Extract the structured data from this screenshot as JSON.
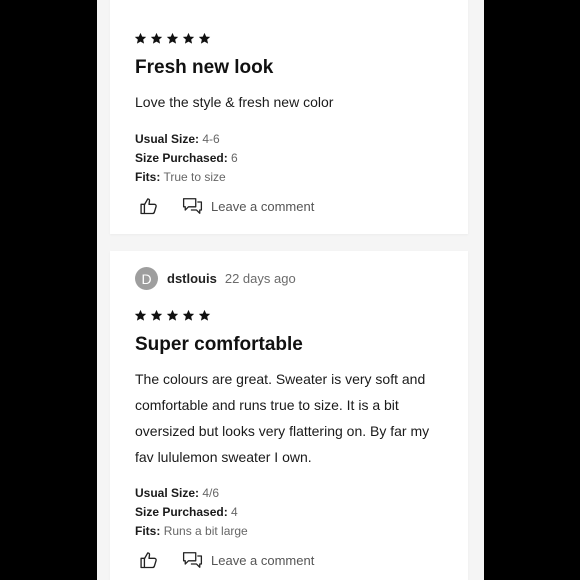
{
  "reviews": [
    {
      "rating": 5,
      "title": "Fresh new look",
      "body": "Love the style & fresh new color",
      "usual_size_label": "Usual Size:",
      "usual_size": "4-6",
      "size_purchased_label": "Size Purchased:",
      "size_purchased": "6",
      "fits_label": "Fits:",
      "fits": "True to size",
      "comment_label": "Leave a comment"
    },
    {
      "avatar_letter": "D",
      "username": "dstlouis",
      "time": "22 days ago",
      "rating": 5,
      "title": "Super comfortable",
      "body": "The colours are great. Sweater is very soft and comfortable and runs true to size. It is a bit oversized but looks very flattering on. By far my fav lululemon sweater I own.",
      "usual_size_label": "Usual Size:",
      "usual_size": "4/6",
      "size_purchased_label": "Size Purchased:",
      "size_purchased": "4",
      "fits_label": "Fits:",
      "fits": "Runs a bit large",
      "comment_label": "Leave a comment"
    }
  ],
  "colors": {
    "avatar_bg": "#9e9e9e",
    "page_bg": "#f5f5f5",
    "frame_bg": "#000000"
  },
  "icons": {
    "star": "star-icon",
    "like": "thumbs-up-icon",
    "comment": "comment-icon"
  }
}
